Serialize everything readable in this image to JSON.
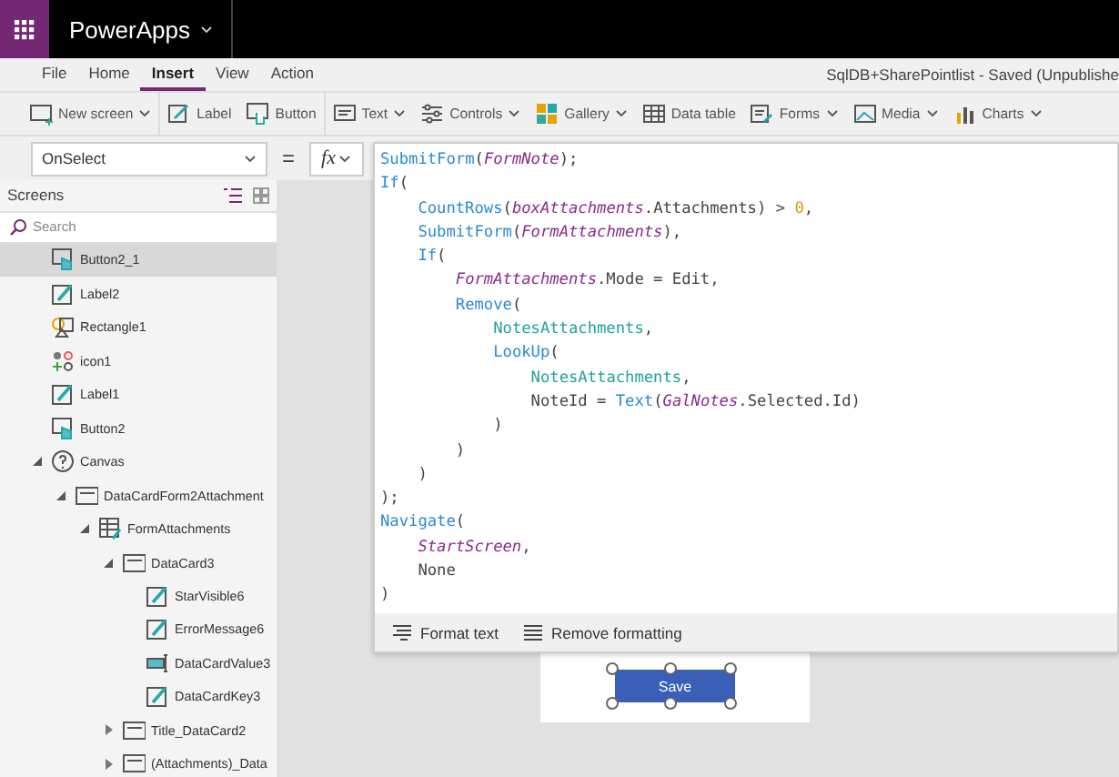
{
  "app_bar": {
    "app_name": "PowerApps"
  },
  "menu": {
    "tabs": [
      {
        "label": "File",
        "selected": false
      },
      {
        "label": "Home",
        "selected": false
      },
      {
        "label": "Insert",
        "selected": true
      },
      {
        "label": "View",
        "selected": false
      },
      {
        "label": "Action",
        "selected": false
      }
    ],
    "document_title": "SqlDB+SharePointlist - Saved (Unpublishe"
  },
  "toolbar": [
    {
      "label": "New screen",
      "kind": "menu"
    },
    {
      "label": "Label",
      "kind": "button"
    },
    {
      "label": "Button",
      "kind": "button"
    },
    {
      "label": "Text",
      "kind": "menu"
    },
    {
      "label": "Controls",
      "kind": "menu"
    },
    {
      "label": "Gallery",
      "kind": "menu"
    },
    {
      "label": "Data table",
      "kind": "button"
    },
    {
      "label": "Forms",
      "kind": "menu"
    },
    {
      "label": "Media",
      "kind": "menu"
    },
    {
      "label": "Charts",
      "kind": "menu"
    }
  ],
  "formula_bar": {
    "property": "OnSelect",
    "equals": "=",
    "fx": "fx"
  },
  "screens_panel": {
    "title": "Screens",
    "search": {
      "placeholder": "Search"
    },
    "tree": [
      {
        "label": "Button2_1",
        "kind": "button",
        "selected": true
      },
      {
        "label": "Label2",
        "kind": "label",
        "selected": false
      },
      {
        "label": "Rectangle1",
        "kind": "shape",
        "selected": false
      },
      {
        "label": "icon1",
        "kind": "icon",
        "selected": false
      },
      {
        "label": "Label1",
        "kind": "label",
        "selected": false
      },
      {
        "label": "Button2",
        "kind": "button",
        "selected": false
      },
      {
        "label": "Canvas",
        "kind": "canvas",
        "selected": false,
        "expanded": true,
        "children": [
          {
            "label": "DataCardForm2Attachment",
            "kind": "card",
            "selected": false,
            "expanded": true,
            "children": [
              {
                "label": "FormAttachments",
                "kind": "form",
                "selected": false,
                "expanded": true,
                "children": [
                  {
                    "label": "DataCard3",
                    "kind": "card",
                    "selected": false,
                    "expanded": true,
                    "children": [
                      {
                        "label": "StarVisible6",
                        "kind": "label",
                        "selected": false
                      },
                      {
                        "label": "ErrorMessage6",
                        "kind": "label",
                        "selected": false
                      },
                      {
                        "label": "DataCardValue3",
                        "kind": "input",
                        "selected": false
                      },
                      {
                        "label": "DataCardKey3",
                        "kind": "label",
                        "selected": false
                      }
                    ]
                  },
                  {
                    "label": "Title_DataCard2",
                    "kind": "card",
                    "selected": false,
                    "expanded": false
                  },
                  {
                    "label": "(Attachments)_Data",
                    "kind": "card",
                    "selected": false,
                    "expanded": false
                  }
                ]
              }
            ]
          }
        ]
      }
    ]
  },
  "code_editor": {
    "lines": [
      {
        "tokens": [
          {
            "kind": "function",
            "text": "SubmitForm"
          },
          {
            "kind": "plain",
            "text": "("
          },
          {
            "kind": "control",
            "text": "FormNote"
          },
          {
            "kind": "plain",
            "text": ");"
          }
        ]
      },
      {
        "tokens": [
          {
            "kind": "function",
            "text": "If"
          },
          {
            "kind": "plain",
            "text": "("
          }
        ],
        "children": [
          {
            "tokens": [
              {
                "kind": "function",
                "text": "CountRows"
              },
              {
                "kind": "plain",
                "text": "("
              },
              {
                "kind": "control",
                "text": "boxAttachments"
              },
              {
                "kind": "plain",
                "text": ".Attachments) > "
              },
              {
                "kind": "number",
                "text": "0"
              },
              {
                "kind": "plain",
                "text": ","
              }
            ]
          },
          {
            "tokens": [
              {
                "kind": "function",
                "text": "SubmitForm"
              },
              {
                "kind": "plain",
                "text": "("
              },
              {
                "kind": "control",
                "text": "FormAttachments"
              },
              {
                "kind": "plain",
                "text": "),"
              }
            ]
          },
          {
            "tokens": [
              {
                "kind": "function",
                "text": "If"
              },
              {
                "kind": "plain",
                "text": "("
              }
            ],
            "children": [
              {
                "tokens": [
                  {
                    "kind": "control",
                    "text": "FormAttachments"
                  },
                  {
                    "kind": "plain",
                    "text": ".Mode = Edit,"
                  }
                ]
              },
              {
                "tokens": [
                  {
                    "kind": "function",
                    "text": "Remove"
                  },
                  {
                    "kind": "plain",
                    "text": "("
                  }
                ],
                "children": [
                  {
                    "tokens": [
                      {
                        "kind": "datasource",
                        "text": "NotesAttachments"
                      },
                      {
                        "kind": "plain",
                        "text": ","
                      }
                    ]
                  },
                  {
                    "tokens": [
                      {
                        "kind": "function",
                        "text": "LookUp"
                      },
                      {
                        "kind": "plain",
                        "text": "("
                      }
                    ],
                    "children": [
                      {
                        "tokens": [
                          {
                            "kind": "datasource",
                            "text": "NotesAttachments"
                          },
                          {
                            "kind": "plain",
                            "text": ","
                          }
                        ]
                      },
                      {
                        "tokens": [
                          {
                            "kind": "plain",
                            "text": "NoteId = "
                          },
                          {
                            "kind": "function",
                            "text": "Text"
                          },
                          {
                            "kind": "plain",
                            "text": "("
                          },
                          {
                            "kind": "control",
                            "text": "GalNotes"
                          },
                          {
                            "kind": "plain",
                            "text": ".Selected.Id)"
                          }
                        ]
                      }
                    ]
                  },
                  {
                    "tokens": [
                      {
                        "kind": "plain",
                        "text": ")"
                      }
                    ]
                  }
                ]
              },
              {
                "tokens": [
                  {
                    "kind": "plain",
                    "text": ")"
                  }
                ]
              }
            ]
          },
          {
            "tokens": [
              {
                "kind": "plain",
                "text": ")"
              }
            ]
          }
        ]
      },
      {
        "tokens": [
          {
            "kind": "plain",
            "text": ");"
          }
        ]
      },
      {
        "tokens": [
          {
            "kind": "function",
            "text": "Navigate"
          },
          {
            "kind": "plain",
            "text": "("
          }
        ],
        "children": [
          {
            "tokens": [
              {
                "kind": "control",
                "text": "StartScreen"
              },
              {
                "kind": "plain",
                "text": ","
              }
            ]
          },
          {
            "tokens": [
              {
                "kind": "plain",
                "text": "None"
              }
            ]
          }
        ]
      },
      {
        "tokens": [
          {
            "kind": "plain",
            "text": ")"
          }
        ]
      }
    ],
    "actions": [
      {
        "label": "Format text"
      },
      {
        "label": "Remove formatting"
      }
    ]
  },
  "canvas": {
    "button_label": "Save"
  }
}
